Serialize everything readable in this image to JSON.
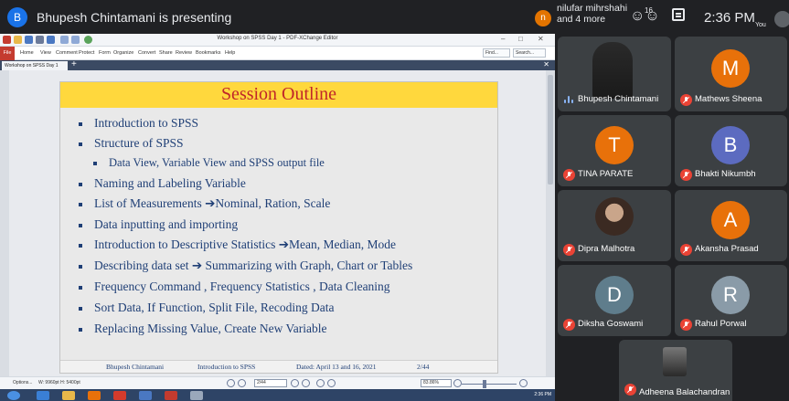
{
  "meet": {
    "presenter_initial": "B",
    "presenting_text": "Bhupesh Chintamani is presenting",
    "others_initial": "n",
    "others_line1": "nilufar mihrshahi",
    "others_line2": "and 4 more",
    "people_count": "16",
    "time": "2:36 PM",
    "you_label": "You"
  },
  "pdf_editor": {
    "window_title": "Workshop on SPSS Day 1 - PDF-XChange Editor",
    "file_tab": "File",
    "ribbon_tabs": [
      "Home",
      "View",
      "Comment",
      "Protect",
      "Form",
      "Organize",
      "Convert",
      "Share",
      "Review",
      "Bookmarks",
      "Help"
    ],
    "find_label": "Find...",
    "search_label": "Search...",
    "doc_tab": "Workshop on SPSS Day 1",
    "status": {
      "options_label": "Options...",
      "dimensions": "W: 9960pt  H: 5400pt",
      "page": "2/44",
      "zoom": "83.86%"
    },
    "taskbar_time": "2:36 PM"
  },
  "slide": {
    "title": "Session Outline",
    "bullets": [
      "Introduction to SPSS",
      "Structure of SPSS",
      "Data View, Variable View and SPSS output file",
      "Naming and Labeling Variable",
      "List of Measurements ➔Nominal, Ration, Scale",
      "Data inputting and importing",
      "Introduction to Descriptive Statistics ➔Mean, Median, Mode",
      "Describing data set ➔ Summarizing with Graph, Chart or Tables",
      "Frequency Command , Frequency Statistics , Data Cleaning",
      "Sort Data, If Function, Split File, Recoding Data",
      "Replacing Missing Value, Create New Variable"
    ],
    "footer": {
      "author": "Bhupesh Chintamani",
      "course": "Introduction to SPSS",
      "dates": "Dated: April 13 and 16, 2021",
      "page": "2/44"
    }
  },
  "participants": [
    {
      "name": "Bhupesh Chintamani",
      "initial": "",
      "color": "",
      "muted": false
    },
    {
      "name": "Mathews Sheena",
      "initial": "M",
      "color": "#e8710a",
      "muted": true
    },
    {
      "name": "TINA PARATE",
      "initial": "T",
      "color": "#e8710a",
      "muted": true
    },
    {
      "name": "Bhakti Nikumbh",
      "initial": "B",
      "color": "#5c6bc0",
      "muted": true
    },
    {
      "name": "Dipra Malhotra",
      "initial": "",
      "color": "",
      "muted": true
    },
    {
      "name": "Akansha Prasad",
      "initial": "A",
      "color": "#e8710a",
      "muted": true
    },
    {
      "name": "Diksha Goswami",
      "initial": "D",
      "color": "#5f7d8c",
      "muted": true
    },
    {
      "name": "Rahul Porwal",
      "initial": "R",
      "color": "#8a9ba8",
      "muted": true
    },
    {
      "name": "Adheena Balachandran",
      "initial": "",
      "color": "",
      "muted": true
    }
  ]
}
